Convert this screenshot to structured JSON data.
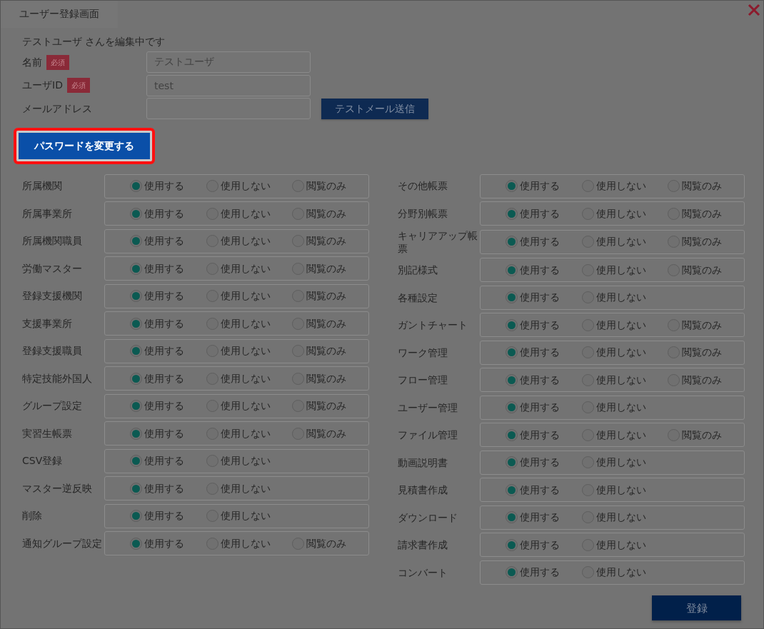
{
  "dialog": {
    "title": "ユーザー登録画面",
    "editing_note": "テストユーザ さんを編集中です"
  },
  "fields": [
    {
      "label": "名前",
      "required_badge": "必須",
      "value": "テストユーザ"
    },
    {
      "label": "ユーザID",
      "required_badge": "必須",
      "value": "test"
    },
    {
      "label": "メールアドレス",
      "action": "テストメール送信"
    }
  ],
  "password_button": {
    "label": "パスワードを変更する",
    "highlighted": true
  },
  "permission_columns": [
    {
      "rows": [
        {
          "label": "所属機関",
          "options": [
            {
              "label": "使用する",
              "selected": true
            },
            {
              "label": "使用しない",
              "selected": false
            },
            {
              "label": "閲覧のみ",
              "selected": false
            }
          ]
        },
        {
          "label": "所属事業所",
          "options": [
            {
              "label": "使用する",
              "selected": true
            },
            {
              "label": "使用しない",
              "selected": false
            },
            {
              "label": "閲覧のみ",
              "selected": false
            }
          ]
        },
        {
          "label": "所属機関職員",
          "options": [
            {
              "label": "使用する",
              "selected": true
            },
            {
              "label": "使用しない",
              "selected": false
            },
            {
              "label": "閲覧のみ",
              "selected": false
            }
          ]
        },
        {
          "label": "労働マスター",
          "options": [
            {
              "label": "使用する",
              "selected": true
            },
            {
              "label": "使用しない",
              "selected": false
            },
            {
              "label": "閲覧のみ",
              "selected": false
            }
          ]
        },
        {
          "label": "登録支援機関",
          "options": [
            {
              "label": "使用する",
              "selected": true
            },
            {
              "label": "使用しない",
              "selected": false
            },
            {
              "label": "閲覧のみ",
              "selected": false
            }
          ]
        },
        {
          "label": "支援事業所",
          "options": [
            {
              "label": "使用する",
              "selected": true
            },
            {
              "label": "使用しない",
              "selected": false
            },
            {
              "label": "閲覧のみ",
              "selected": false
            }
          ]
        },
        {
          "label": "登録支援職員",
          "options": [
            {
              "label": "使用する",
              "selected": true
            },
            {
              "label": "使用しない",
              "selected": false
            },
            {
              "label": "閲覧のみ",
              "selected": false
            }
          ]
        },
        {
          "label": "特定技能外国人",
          "options": [
            {
              "label": "使用する",
              "selected": true
            },
            {
              "label": "使用しない",
              "selected": false
            },
            {
              "label": "閲覧のみ",
              "selected": false
            }
          ]
        },
        {
          "label": "グループ設定",
          "options": [
            {
              "label": "使用する",
              "selected": true
            },
            {
              "label": "使用しない",
              "selected": false
            },
            {
              "label": "閲覧のみ",
              "selected": false
            }
          ]
        },
        {
          "label": "実習生帳票",
          "options": [
            {
              "label": "使用する",
              "selected": true
            },
            {
              "label": "使用しない",
              "selected": false
            },
            {
              "label": "閲覧のみ",
              "selected": false
            }
          ]
        },
        {
          "label": "CSV登録",
          "options": [
            {
              "label": "使用する",
              "selected": true
            },
            {
              "label": "使用しない",
              "selected": false
            }
          ]
        },
        {
          "label": "マスター逆反映",
          "options": [
            {
              "label": "使用する",
              "selected": true
            },
            {
              "label": "使用しない",
              "selected": false
            }
          ]
        },
        {
          "label": "削除",
          "options": [
            {
              "label": "使用する",
              "selected": true
            },
            {
              "label": "使用しない",
              "selected": false
            }
          ]
        },
        {
          "label": "通知グループ設定",
          "options": [
            {
              "label": "使用する",
              "selected": true
            },
            {
              "label": "使用しない",
              "selected": false
            },
            {
              "label": "閲覧のみ",
              "selected": false
            }
          ]
        }
      ]
    },
    {
      "rows": [
        {
          "label": "その他帳票",
          "options": [
            {
              "label": "使用する",
              "selected": true
            },
            {
              "label": "使用しない",
              "selected": false
            },
            {
              "label": "閲覧のみ",
              "selected": false
            }
          ]
        },
        {
          "label": "分野別帳票",
          "options": [
            {
              "label": "使用する",
              "selected": true
            },
            {
              "label": "使用しない",
              "selected": false
            },
            {
              "label": "閲覧のみ",
              "selected": false
            }
          ]
        },
        {
          "label": "キャリアアップ帳票",
          "options": [
            {
              "label": "使用する",
              "selected": true
            },
            {
              "label": "使用しない",
              "selected": false
            },
            {
              "label": "閲覧のみ",
              "selected": false
            }
          ]
        },
        {
          "label": "別記様式",
          "options": [
            {
              "label": "使用する",
              "selected": true
            },
            {
              "label": "使用しない",
              "selected": false
            },
            {
              "label": "閲覧のみ",
              "selected": false
            }
          ]
        },
        {
          "label": "各種設定",
          "options": [
            {
              "label": "使用する",
              "selected": true
            },
            {
              "label": "使用しない",
              "selected": false
            }
          ]
        },
        {
          "label": "ガントチャート",
          "options": [
            {
              "label": "使用する",
              "selected": true
            },
            {
              "label": "使用しない",
              "selected": false
            },
            {
              "label": "閲覧のみ",
              "selected": false
            }
          ]
        },
        {
          "label": "ワーク管理",
          "options": [
            {
              "label": "使用する",
              "selected": true
            },
            {
              "label": "使用しない",
              "selected": false
            },
            {
              "label": "閲覧のみ",
              "selected": false
            }
          ]
        },
        {
          "label": "フロー管理",
          "options": [
            {
              "label": "使用する",
              "selected": true
            },
            {
              "label": "使用しない",
              "selected": false
            },
            {
              "label": "閲覧のみ",
              "selected": false
            }
          ]
        },
        {
          "label": "ユーザー管理",
          "options": [
            {
              "label": "使用する",
              "selected": true
            },
            {
              "label": "使用しない",
              "selected": false
            }
          ]
        },
        {
          "label": "ファイル管理",
          "options": [
            {
              "label": "使用する",
              "selected": true
            },
            {
              "label": "使用しない",
              "selected": false
            },
            {
              "label": "閲覧のみ",
              "selected": false
            }
          ]
        },
        {
          "label": "動画説明書",
          "options": [
            {
              "label": "使用する",
              "selected": true
            },
            {
              "label": "使用しない",
              "selected": false
            }
          ]
        },
        {
          "label": "見積書作成",
          "options": [
            {
              "label": "使用する",
              "selected": true
            },
            {
              "label": "使用しない",
              "selected": false
            }
          ]
        },
        {
          "label": "ダウンロード",
          "options": [
            {
              "label": "使用する",
              "selected": true
            },
            {
              "label": "使用しない",
              "selected": false
            }
          ]
        },
        {
          "label": "請求書作成",
          "options": [
            {
              "label": "使用する",
              "selected": true
            },
            {
              "label": "使用しない",
              "selected": false
            }
          ]
        },
        {
          "label": "コンバート",
          "options": [
            {
              "label": "使用する",
              "selected": true
            },
            {
              "label": "使用しない",
              "selected": false
            }
          ]
        }
      ]
    }
  ],
  "submit_button": "登録"
}
